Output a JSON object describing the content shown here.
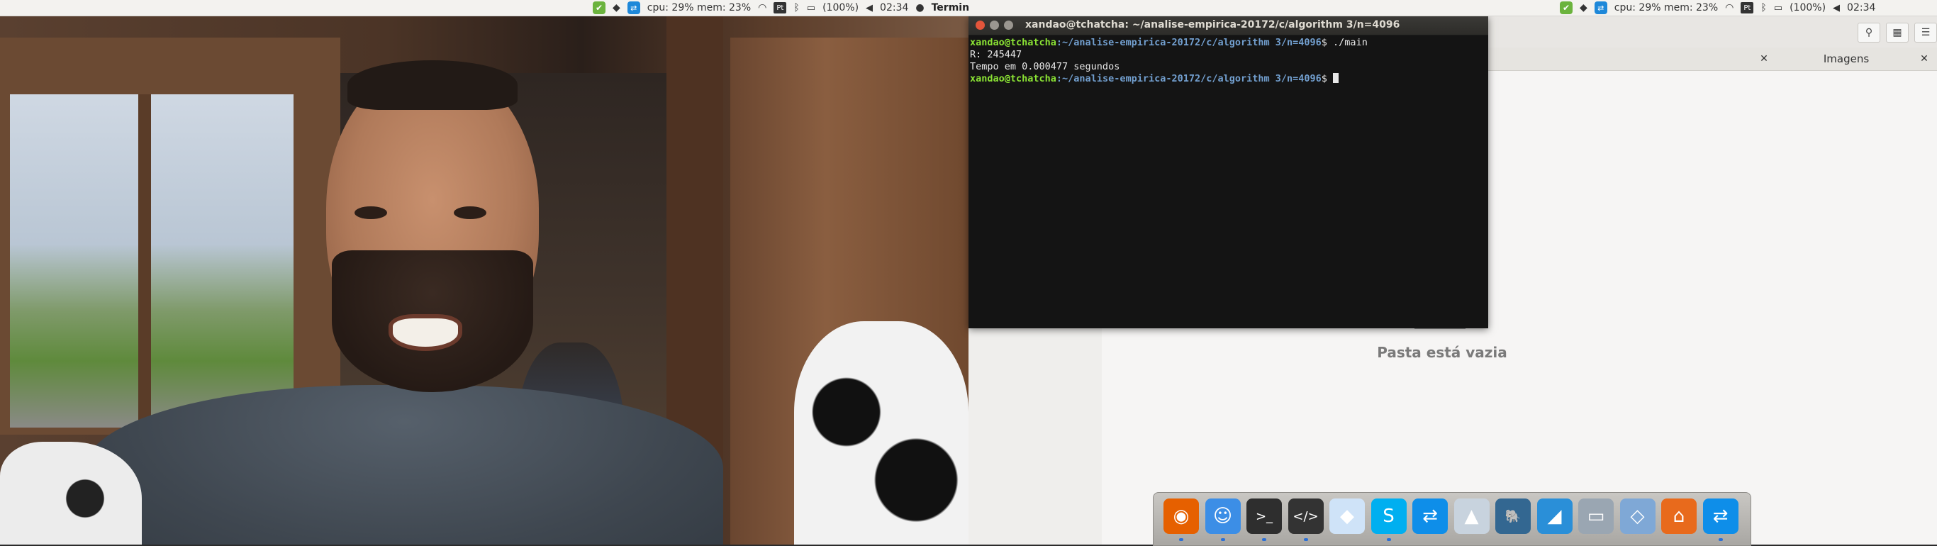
{
  "topbar_left": {
    "app_name": "Terminal",
    "cpu_mem": "cpu: 29% mem: 23%",
    "battery": "(100%)",
    "time": "02:34",
    "keyboard": "Pt"
  },
  "topbar_right": {
    "cpu_mem": "cpu: 29% mem: 23%",
    "battery": "(100%)",
    "time": "02:34",
    "keyboard": "Pt"
  },
  "terminal": {
    "title": "xandao@tchatcha: ~/analise-empirica-20172/c/algorithm 3/n=4096",
    "lines": [
      {
        "user": "xandao@tchatcha",
        "path": ":~/analise-empirica-20172/c/algorithm 3/n=4096",
        "cmd": "$ ./main"
      },
      {
        "text": "R: 245447"
      },
      {
        "text": "Tempo em 0.000477 segundos"
      },
      {
        "user": "xandao@tchatcha",
        "path": ":~/analise-empirica-20172/c/algorithm 3/n=4096",
        "cmd": "$ "
      }
    ]
  },
  "file_manager": {
    "tab_label": "Imagens",
    "empty_message": "Pasta está vazia",
    "close_glyph": "✕"
  },
  "dock": {
    "items": [
      {
        "icon": "firefox-icon",
        "color": "#e66000",
        "glyph": "◉",
        "active": true
      },
      {
        "icon": "finder-icon",
        "color": "#3c8ee6",
        "glyph": "☺",
        "active": true
      },
      {
        "icon": "terminal-icon",
        "color": "#2e2e2e",
        "glyph": ">_",
        "active": true
      },
      {
        "icon": "code-editor-icon",
        "color": "#333333",
        "glyph": "</>",
        "active": true
      },
      {
        "icon": "dropbox-icon",
        "color": "#cfe3f8",
        "glyph": "◆",
        "active": false
      },
      {
        "icon": "skype-icon",
        "color": "#00aff0",
        "glyph": "S",
        "active": true
      },
      {
        "icon": "teamviewer-icon",
        "color": "#0e8ee9",
        "glyph": "⇄",
        "active": false
      },
      {
        "icon": "matlab-icon",
        "color": "#c8d3de",
        "glyph": "▲",
        "active": false
      },
      {
        "icon": "postgresql-icon",
        "color": "#336791",
        "glyph": "🐘",
        "active": false
      },
      {
        "icon": "mysql-workbench-icon",
        "color": "#2a8fd8",
        "glyph": "◢",
        "active": false
      },
      {
        "icon": "scanner-icon",
        "color": "#9aa6b2",
        "glyph": "▭",
        "active": false
      },
      {
        "icon": "virtualbox-icon",
        "color": "#7fa8d6",
        "glyph": "◇",
        "active": false
      },
      {
        "icon": "network-app-icon",
        "color": "#e86a1c",
        "glyph": "⌂",
        "active": false
      },
      {
        "icon": "teamviewer-2-icon",
        "color": "#0e8ee9",
        "glyph": "⇄",
        "active": true
      }
    ]
  }
}
